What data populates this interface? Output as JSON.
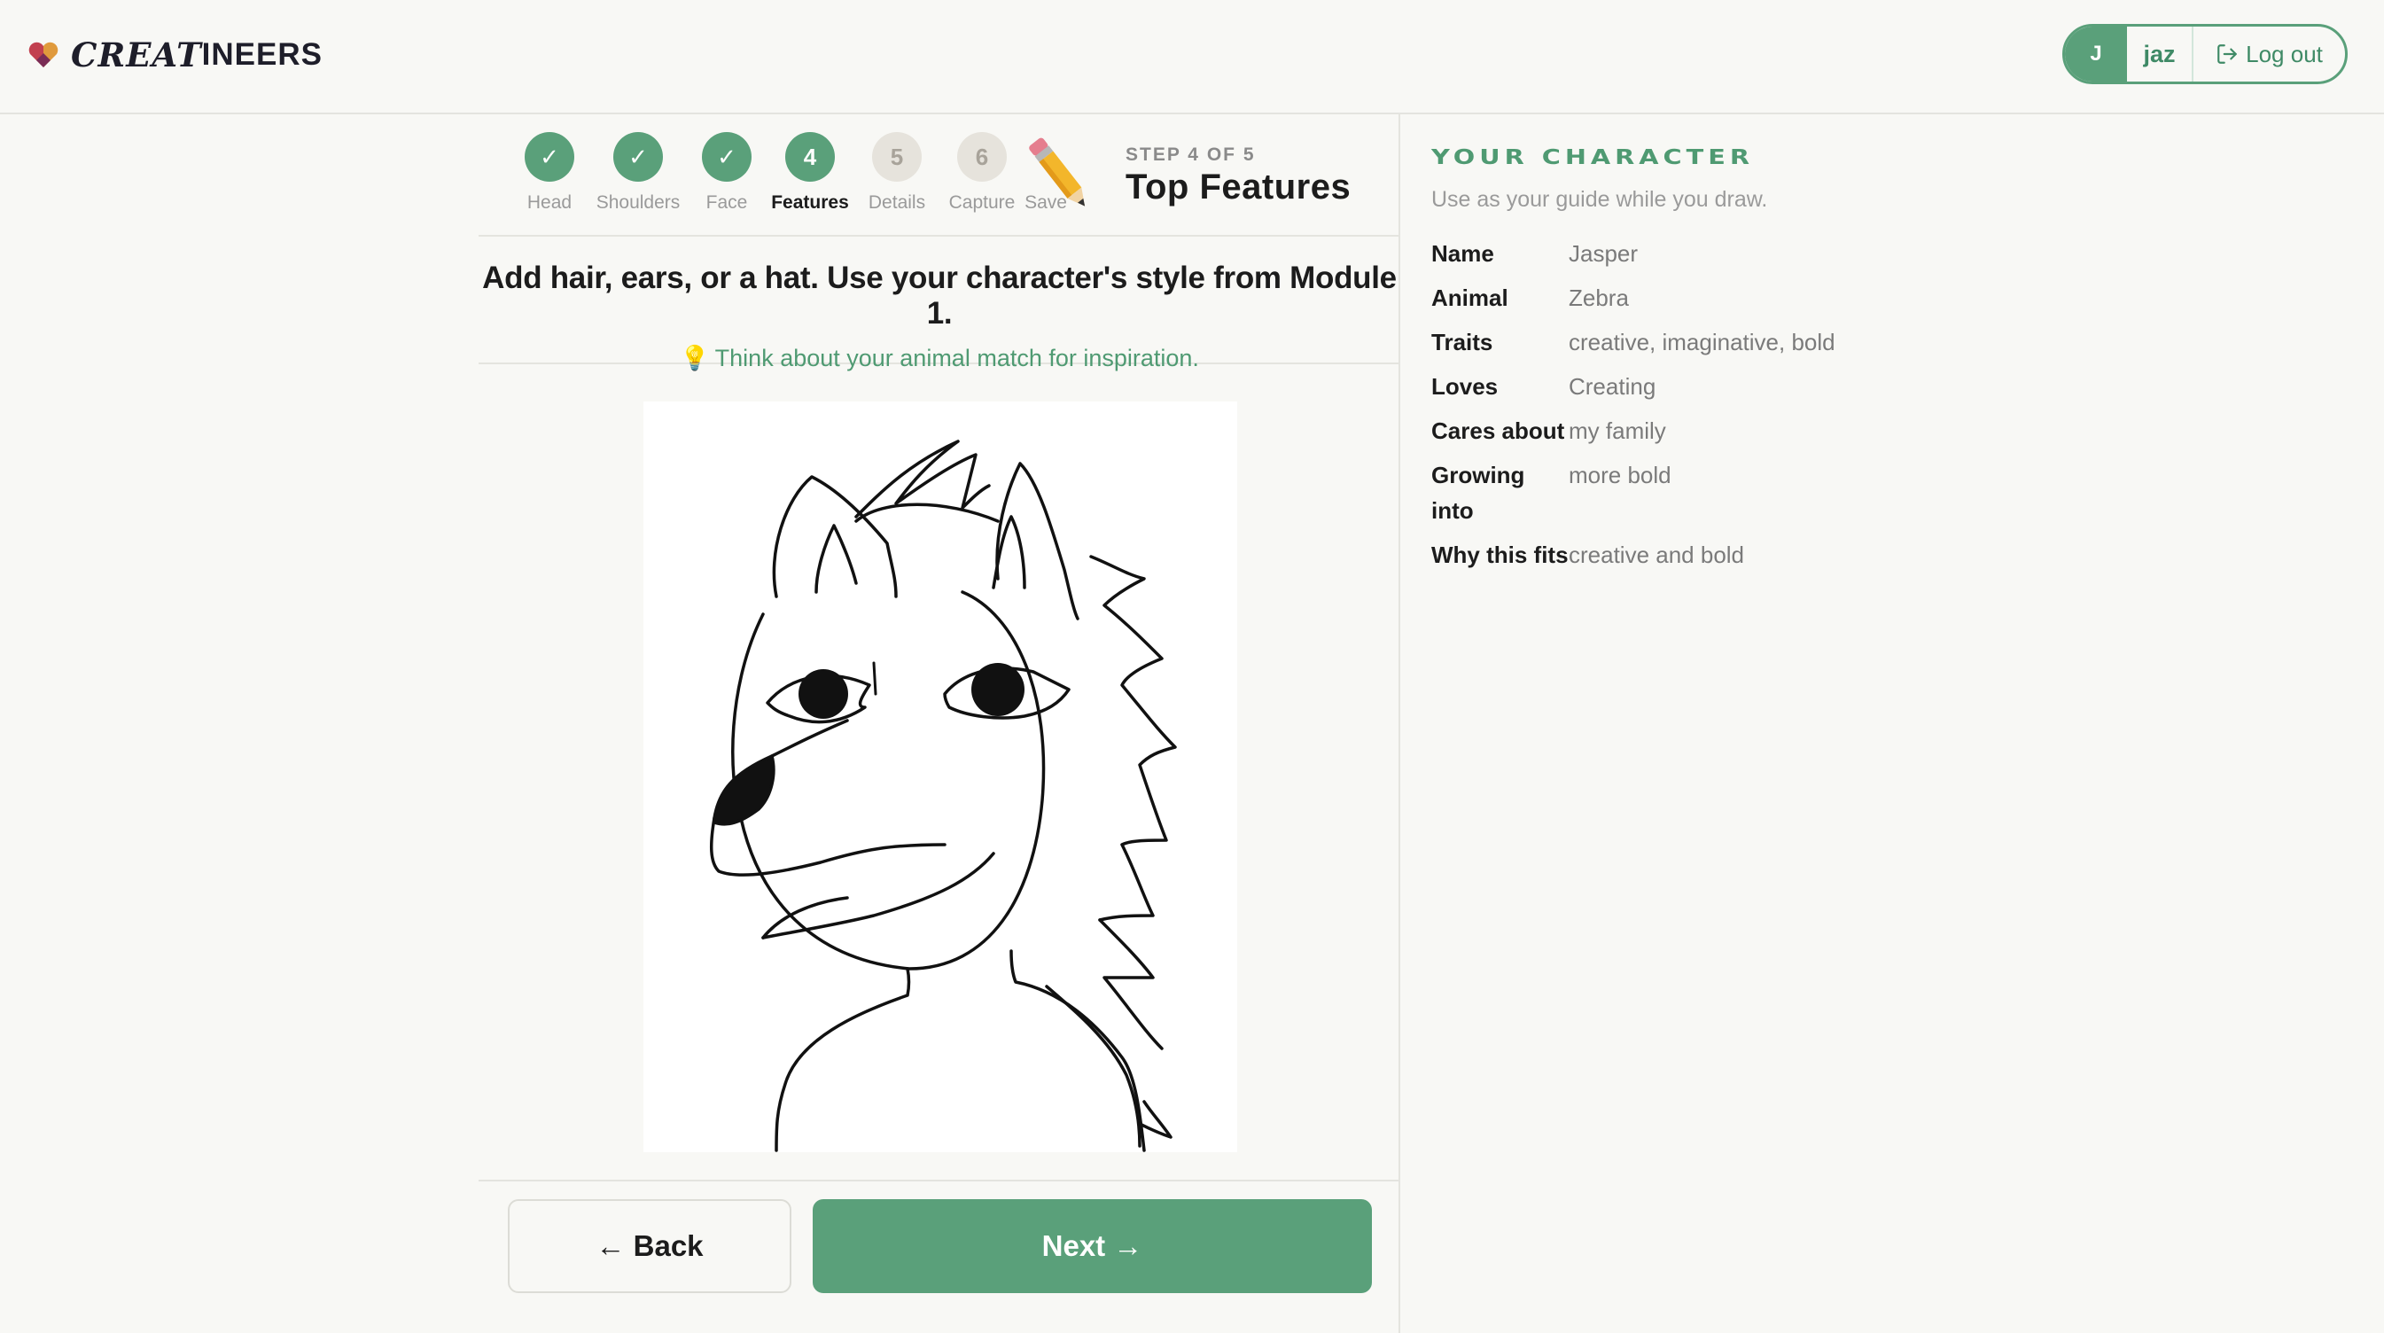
{
  "brand": {
    "name_part1": "CREAT",
    "name_part2": "INEERS"
  },
  "user": {
    "initial": "J",
    "name": "jaz",
    "logout_label": "Log out"
  },
  "stepper": {
    "steps": [
      {
        "number": "✓",
        "label": "Head",
        "state": "done"
      },
      {
        "number": "✓",
        "label": "Shoulders",
        "state": "done"
      },
      {
        "number": "✓",
        "label": "Face",
        "state": "done"
      },
      {
        "number": "4",
        "label": "Features",
        "state": "current"
      },
      {
        "number": "5",
        "label": "Details",
        "state": "todo"
      },
      {
        "number": "6",
        "label": "Capture",
        "state": "todo"
      },
      {
        "number": "",
        "label": "Save",
        "state": "todo"
      }
    ],
    "kicker": "STEP 4 OF 5",
    "title": "Top Features"
  },
  "instruction": {
    "headline": "Add hair, ears, or a hat. Use your character's style from Module 1.",
    "hint": "Think about your animal match for inspiration."
  },
  "actions": {
    "back_label": "← Back",
    "next_label": "Next →"
  },
  "character": {
    "title": "YOUR CHARACTER",
    "subtitle": "Use as your guide while you draw.",
    "fields": [
      {
        "key": "Name",
        "value": "Jasper"
      },
      {
        "key": "Animal",
        "value": "Zebra"
      },
      {
        "key": "Traits",
        "value": "creative, imaginative, bold"
      },
      {
        "key": "Loves",
        "value": "Creating"
      },
      {
        "key": "Cares about",
        "value": "my family"
      },
      {
        "key": "Growing into",
        "value": "more bold"
      },
      {
        "key": "Why this fits",
        "value": "creative and bold"
      }
    ]
  },
  "colors": {
    "accent": "#5aa07a",
    "accent_text": "#4f9a72",
    "background": "#f8f8f5"
  }
}
